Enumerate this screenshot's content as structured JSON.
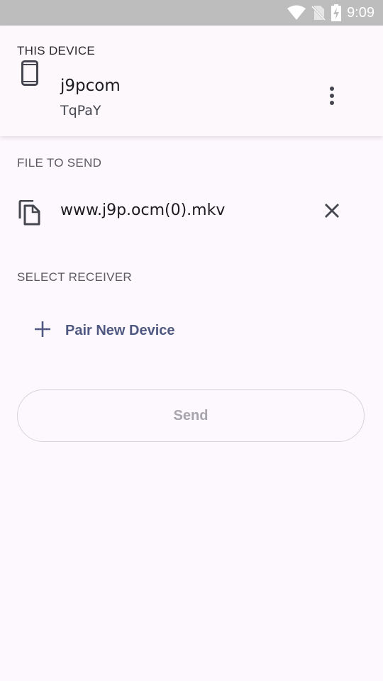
{
  "status_bar": {
    "time": "9:09",
    "icons": [
      "wifi-icon",
      "no-sim-icon",
      "battery-charging-icon"
    ]
  },
  "this_device": {
    "header": "THIS DEVICE",
    "name": "j9pcom",
    "id": "TqPaY",
    "icon": "smartphone-icon",
    "menu_icon": "more-vert-icon"
  },
  "file_to_send": {
    "header": "FILE TO SEND",
    "file_name": "www.j9p.ocm(0).mkv",
    "icon": "file-copy-icon",
    "clear_icon": "close-icon"
  },
  "receiver": {
    "header": "SELECT RECEIVER",
    "pair_label": "Pair New Device",
    "pair_icon": "add-icon"
  },
  "send_button": {
    "label": "Send",
    "enabled": false
  },
  "colors": {
    "background": "#fdf8fd",
    "accent": "#4f5880",
    "status_bar": "#bdbdbd",
    "disabled_text": "#a6a5ab"
  }
}
